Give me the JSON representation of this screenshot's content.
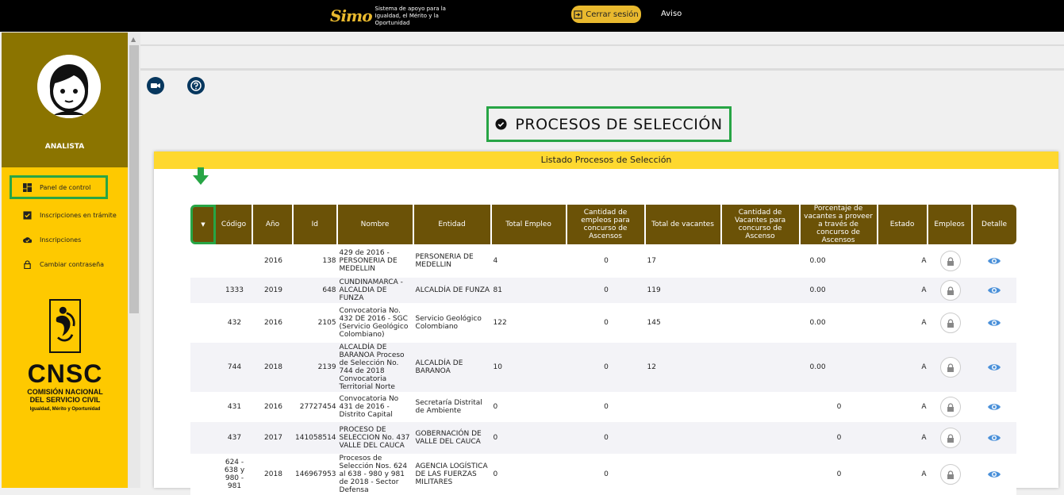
{
  "header": {
    "logo_mark": "Simo",
    "logo_tagline": "Sistema de apoyo para la Igualdad, el Mérito y la Oportunidad",
    "logout_label": "Cerrar sesión",
    "notice_label": "Aviso"
  },
  "sidebar": {
    "role": "ANALISTA",
    "items": [
      {
        "label": "Panel de control",
        "icon": "dashboard-icon"
      },
      {
        "label": "Inscripciones en trámite",
        "icon": "checkbox-icon"
      },
      {
        "label": "Inscripciones",
        "icon": "cloud-check-icon"
      },
      {
        "label": "Cambiar contraseña",
        "icon": "lock-icon"
      }
    ],
    "org_logo": {
      "acronym": "CNSC",
      "line1": "COMISIÓN NACIONAL",
      "line2": "DEL SERVICIO CIVIL",
      "line3": "Igualdad, Mérito y Oportunidad"
    }
  },
  "page": {
    "title": "PROCESOS DE SELECCIÓN",
    "panel_title": "Listado Procesos de Selección"
  },
  "table": {
    "columns": [
      "",
      "Código",
      "Año",
      "Id",
      "Nombre",
      "Entidad",
      "Total Empleo",
      "Cantidad de empleos para concurso de Ascensos",
      "Total de vacantes",
      "Cantidad de Vacantes para concurso de Ascenso",
      "Porcentaje de vacantes a proveer a través de concurso de Ascensos",
      "Estado",
      "Empleos",
      "Detalle"
    ],
    "rows": [
      {
        "codigo": "",
        "anio": "2016",
        "id": "138",
        "nombre": "429 de 2016 - PERSONERIA DE MEDELLIN",
        "entidad": "PERSONERIA DE MEDELLIN",
        "total_empleo": "4",
        "empleos_ascenso": "0",
        "total_vacantes": "17",
        "vacantes_ascenso": "",
        "porcentaje": "0.00",
        "estado": "A"
      },
      {
        "codigo": "1333",
        "anio": "2019",
        "id": "648",
        "nombre": "CUNDINAMARCA - ALCALDIA DE FUNZA",
        "entidad": "ALCALDÍA DE FUNZA",
        "total_empleo": "81",
        "empleos_ascenso": "0",
        "total_vacantes": "119",
        "vacantes_ascenso": "",
        "porcentaje": "0.00",
        "estado": "A"
      },
      {
        "codigo": "432",
        "anio": "2016",
        "id": "2105",
        "nombre": "Convocatoria No. 432 DE 2016 - SGC (Servicio Geológico Colombiano)",
        "entidad": "Servicio Geológico Colombiano",
        "total_empleo": "122",
        "empleos_ascenso": "0",
        "total_vacantes": "145",
        "vacantes_ascenso": "",
        "porcentaje": "0.00",
        "estado": "A"
      },
      {
        "codigo": "744",
        "anio": "2018",
        "id": "2139",
        "nombre": "ALCALDÍA DE BARANOA Proceso de Selección No. 744 de 2018 Convocatoria Territorial Norte",
        "entidad": "ALCALDÍA DE BARANOA",
        "total_empleo": "10",
        "empleos_ascenso": "0",
        "total_vacantes": "12",
        "vacantes_ascenso": "",
        "porcentaje": "0.00",
        "estado": "A"
      },
      {
        "codigo": "431",
        "anio": "2016",
        "id": "27727454",
        "nombre": "Convocatoria No 431 de 2016 - Distrito Capital",
        "entidad": "Secretaría Distrital de Ambiente",
        "total_empleo": "0",
        "empleos_ascenso": "0",
        "total_vacantes": "",
        "vacantes_ascenso": "",
        "porcentaje": "0",
        "estado": "A"
      },
      {
        "codigo": "437",
        "anio": "2017",
        "id": "141058514",
        "nombre": "PROCESO DE SELECCION No. 437 VALLE DEL CAUCA",
        "entidad": "GOBERNACIÓN DE VALLE DEL CAUCA",
        "total_empleo": "0",
        "empleos_ascenso": "0",
        "total_vacantes": "",
        "vacantes_ascenso": "",
        "porcentaje": "0",
        "estado": "A"
      },
      {
        "codigo": "624 - 638 y 980 - 981",
        "anio": "2018",
        "id": "146967953",
        "nombre": "Procesos de Selección Nos. 624 al 638 - 980 y 981 de 2018 - Sector Defensa",
        "entidad": "AGENCIA LOGÍSTICA DE LAS FUERZAS MILITARES",
        "total_empleo": "0",
        "empleos_ascenso": "0",
        "total_vacantes": "",
        "vacantes_ascenso": "",
        "porcentaje": "0",
        "estado": "A"
      }
    ]
  },
  "colors": {
    "top_bar": "#000000",
    "accent_yellow": "#fec900",
    "sidebar_head": "#8b7400",
    "table_header": "#6b5207",
    "highlight_green": "#27a545",
    "eye_icon": "#4a90d9"
  }
}
